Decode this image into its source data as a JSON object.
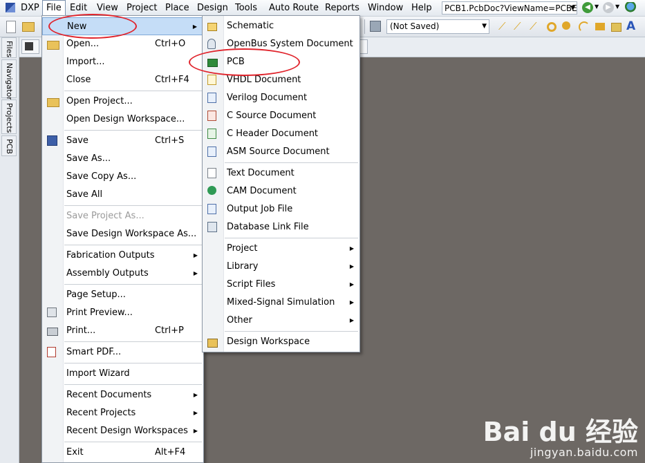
{
  "menubar": {
    "items": [
      "DXP",
      "File",
      "Edit",
      "View",
      "Project",
      "Place",
      "Design",
      "Tools",
      "Auto Route",
      "Reports",
      "Window",
      "Help"
    ],
    "document_selector": "PCB1.PcbDoc?ViewName=PCBE"
  },
  "toolbar": {
    "variant_select": "(Not Saved)"
  },
  "left_panel": {
    "tabs": [
      "Files",
      "Navigator",
      "Projects",
      "PCB"
    ]
  },
  "file_menu": {
    "items": [
      {
        "label": "New",
        "shortcut": "",
        "submenu": true,
        "icon": ""
      },
      {
        "label": "Open...",
        "shortcut": "Ctrl+O",
        "submenu": false,
        "icon": "open-folder-icon"
      },
      {
        "label": "Import...",
        "shortcut": "",
        "submenu": false,
        "icon": ""
      },
      {
        "label": "Close",
        "shortcut": "Ctrl+F4",
        "submenu": false,
        "icon": ""
      },
      {
        "label": "Open Project...",
        "shortcut": "",
        "submenu": false,
        "icon": "open-project-icon"
      },
      {
        "label": "Open Design Workspace...",
        "shortcut": "",
        "submenu": false,
        "icon": ""
      },
      {
        "label": "Save",
        "shortcut": "Ctrl+S",
        "submenu": false,
        "icon": "save-icon"
      },
      {
        "label": "Save As...",
        "shortcut": "",
        "submenu": false,
        "icon": ""
      },
      {
        "label": "Save Copy As...",
        "shortcut": "",
        "submenu": false,
        "icon": ""
      },
      {
        "label": "Save All",
        "shortcut": "",
        "submenu": false,
        "icon": ""
      },
      {
        "label": "Save Project As...",
        "shortcut": "",
        "submenu": false,
        "icon": "",
        "disabled": true
      },
      {
        "label": "Save Design Workspace As...",
        "shortcut": "",
        "submenu": false,
        "icon": ""
      },
      {
        "label": "Fabrication Outputs",
        "shortcut": "",
        "submenu": true,
        "icon": ""
      },
      {
        "label": "Assembly Outputs",
        "shortcut": "",
        "submenu": true,
        "icon": ""
      },
      {
        "label": "Page Setup...",
        "shortcut": "",
        "submenu": false,
        "icon": ""
      },
      {
        "label": "Print Preview...",
        "shortcut": "",
        "submenu": false,
        "icon": "print-preview-icon"
      },
      {
        "label": "Print...",
        "shortcut": "Ctrl+P",
        "submenu": false,
        "icon": "printer-icon"
      },
      {
        "label": "Smart PDF...",
        "shortcut": "",
        "submenu": false,
        "icon": "pdf-icon"
      },
      {
        "label": "Import Wizard",
        "shortcut": "",
        "submenu": false,
        "icon": ""
      },
      {
        "label": "Recent Documents",
        "shortcut": "",
        "submenu": true,
        "icon": ""
      },
      {
        "label": "Recent Projects",
        "shortcut": "",
        "submenu": true,
        "icon": ""
      },
      {
        "label": "Recent Design Workspaces",
        "shortcut": "",
        "submenu": true,
        "icon": ""
      },
      {
        "label": "Exit",
        "shortcut": "Alt+F4",
        "submenu": false,
        "icon": ""
      }
    ]
  },
  "new_submenu": {
    "items": [
      {
        "label": "Schematic",
        "submenu": false,
        "icon": "schematic-icon"
      },
      {
        "label": "OpenBus System Document",
        "submenu": false,
        "icon": "openbus-icon"
      },
      {
        "label": "PCB",
        "submenu": false,
        "icon": "pcb-icon"
      },
      {
        "label": "VHDL Document",
        "submenu": false,
        "icon": "vhdl-icon"
      },
      {
        "label": "Verilog Document",
        "submenu": false,
        "icon": "verilog-icon"
      },
      {
        "label": "C Source Document",
        "submenu": false,
        "icon": "c-source-icon"
      },
      {
        "label": "C Header Document",
        "submenu": false,
        "icon": "c-header-icon"
      },
      {
        "label": "ASM Source Document",
        "submenu": false,
        "icon": "asm-icon"
      },
      {
        "label": "Text Document",
        "submenu": false,
        "icon": "text-doc-icon"
      },
      {
        "label": "CAM Document",
        "submenu": false,
        "icon": "cam-icon"
      },
      {
        "label": "Output Job File",
        "submenu": false,
        "icon": "output-job-icon"
      },
      {
        "label": "Database Link File",
        "submenu": false,
        "icon": "database-link-icon"
      },
      {
        "label": "Project",
        "submenu": true,
        "icon": ""
      },
      {
        "label": "Library",
        "submenu": true,
        "icon": ""
      },
      {
        "label": "Script Files",
        "submenu": true,
        "icon": ""
      },
      {
        "label": "Mixed-Signal Simulation",
        "submenu": true,
        "icon": ""
      },
      {
        "label": "Other",
        "submenu": true,
        "icon": ""
      },
      {
        "label": "Design Workspace",
        "submenu": false,
        "icon": "design-workspace-icon"
      }
    ]
  },
  "watermark": {
    "logo": "Bai du 经验",
    "url": "jingyan.baidu.com"
  },
  "colors": {
    "workspace_bg": "#6d6864",
    "highlight": "#c5ddf7",
    "annotation_red": "#e0242c"
  }
}
